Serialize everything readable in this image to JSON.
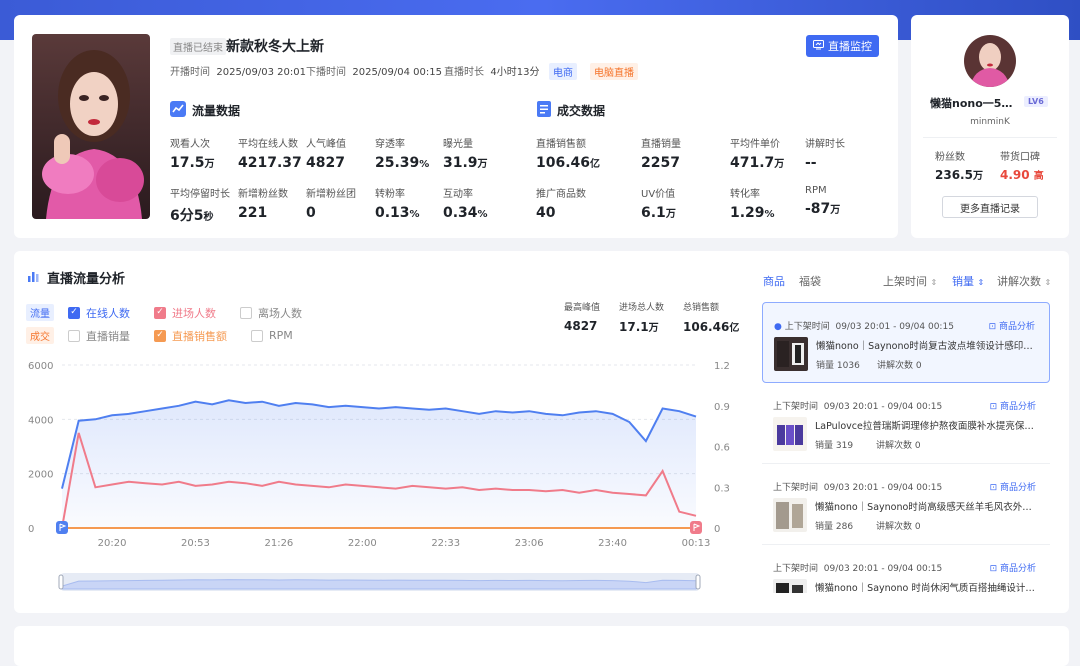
{
  "live": {
    "status_tag": "直播已结束",
    "title": "新款秋冬大上新",
    "monitor_button": "直播监控",
    "start_label": "开播时间",
    "start_time": "2025/09/03 20:01",
    "end_label": "下播时间",
    "end_time": "2025/09/04 00:15",
    "duration_label": "直播时长",
    "duration": "4小时13分",
    "tags": [
      "电商",
      "电脑直播"
    ]
  },
  "traffic": {
    "section_title": "流量数据",
    "metrics": [
      {
        "label": "观看人次",
        "value": "17.5",
        "unit": "万"
      },
      {
        "label": "平均在线人数",
        "value": "4217.37",
        "unit": ""
      },
      {
        "label": "人气峰值",
        "value": "4827",
        "unit": ""
      },
      {
        "label": "穿透率",
        "value": "25.39",
        "unit": "%"
      },
      {
        "label": "曝光量",
        "value": "31.9",
        "unit": "万"
      },
      {
        "label": "平均停留时长",
        "value": "6分5",
        "unit": "秒"
      },
      {
        "label": "新增粉丝数",
        "value": "221",
        "unit": ""
      },
      {
        "label": "新增粉丝团",
        "value": "0",
        "unit": ""
      },
      {
        "label": "转粉率",
        "value": "0.13",
        "unit": "%"
      },
      {
        "label": "互动率",
        "value": "0.34",
        "unit": "%"
      }
    ]
  },
  "sales": {
    "section_title": "成交数据",
    "metrics": [
      {
        "label": "直播销售额",
        "value": "106.46",
        "unit": "亿"
      },
      {
        "label": "直播销量",
        "value": "2257",
        "unit": ""
      },
      {
        "label": "平均件单价",
        "value": "471.7",
        "unit": "万"
      },
      {
        "label": "讲解时长",
        "value": "--",
        "unit": ""
      },
      {
        "label": "推广商品数",
        "value": "40",
        "unit": ""
      },
      {
        "label": "UV价值",
        "value": "6.1",
        "unit": "万"
      },
      {
        "label": "转化率",
        "value": "1.29",
        "unit": "%"
      },
      {
        "label": "RPM",
        "value": "-87",
        "unit": "万"
      }
    ]
  },
  "host": {
    "name": "懒猫nono一5…",
    "level": "LV6",
    "id": "minminK",
    "fans_label": "粉丝数",
    "fans_value": "236.5",
    "fans_unit": "万",
    "rep_label": "带货口碑",
    "rep_value": "4.90",
    "rep_unit": "高",
    "more_button": "更多直播记录"
  },
  "flow": {
    "title": "直播流量分析",
    "group_traffic": "流量",
    "group_sales": "成交",
    "legend_online": "在线人数",
    "legend_enter": "进场人数",
    "legend_leave": "离场人数",
    "legend_sales_vol": "直播销量",
    "legend_sales_amt": "直播销售额",
    "legend_rpm": "RPM",
    "summary": [
      {
        "label": "最高峰值",
        "value": "4827",
        "unit": ""
      },
      {
        "label": "进场总人数",
        "value": "17.1",
        "unit": "万"
      },
      {
        "label": "总销售额",
        "value": "106.46",
        "unit": "亿"
      }
    ]
  },
  "colors": {
    "online": "#4f7ff0",
    "enter": "#f07b8a",
    "sales_amt": "#f59a52",
    "accent": "#3f6af2"
  },
  "chart_data": {
    "type": "line",
    "x": [
      "20:01",
      "20:07",
      "20:13",
      "20:20",
      "20:26",
      "20:33",
      "20:40",
      "20:46",
      "20:53",
      "21:00",
      "21:06",
      "21:13",
      "21:20",
      "21:26",
      "21:33",
      "21:40",
      "21:46",
      "21:53",
      "22:00",
      "22:06",
      "22:13",
      "22:20",
      "22:26",
      "22:33",
      "22:40",
      "22:46",
      "22:53",
      "23:00",
      "23:06",
      "23:13",
      "23:20",
      "23:26",
      "23:33",
      "23:40",
      "23:46",
      "23:53",
      "24:00",
      "00:06",
      "00:13"
    ],
    "x_ticks": [
      "20:20",
      "20:53",
      "21:26",
      "22:00",
      "22:33",
      "23:06",
      "23:40",
      "00:13"
    ],
    "y_left_ticks": [
      "6000",
      "4000",
      "2000",
      "0"
    ],
    "y_right_ticks": [
      "1.2",
      "0.9",
      "0.6",
      "0.3",
      "0"
    ],
    "ylim_left": [
      0,
      6000
    ],
    "ylim_right": [
      0,
      1.2
    ],
    "series": [
      {
        "name": "在线人数",
        "values": [
          1450,
          3950,
          4000,
          4150,
          4200,
          4300,
          4400,
          4500,
          4650,
          4550,
          4700,
          4600,
          4650,
          4500,
          4600,
          4550,
          4450,
          4500,
          4450,
          4400,
          4450,
          4400,
          4350,
          4400,
          4300,
          4200,
          4300,
          4250,
          4300,
          4200,
          4150,
          4250,
          4300,
          4200,
          3900,
          3200,
          4400,
          4300,
          4100
        ]
      },
      {
        "name": "进场人数",
        "values": [
          0,
          3500,
          1500,
          1600,
          1700,
          1650,
          1600,
          1700,
          1550,
          1600,
          1700,
          1650,
          1550,
          1700,
          1600,
          1550,
          1500,
          1600,
          1550,
          1500,
          1450,
          1550,
          1500,
          1450,
          1500,
          1400,
          1450,
          1400,
          1400,
          1350,
          1400,
          1300,
          1400,
          1300,
          1250,
          1200,
          2100,
          600,
          450
        ]
      },
      {
        "name": "直播销售额",
        "values": [
          0,
          0,
          0,
          0,
          0,
          0,
          0,
          0,
          0,
          0,
          0,
          0,
          0,
          0,
          0,
          0,
          0,
          0,
          0,
          0,
          0,
          0,
          0,
          0,
          0,
          0,
          0,
          0,
          0,
          0,
          0,
          0,
          0,
          0,
          0,
          0,
          0,
          0,
          0
        ]
      }
    ]
  },
  "products": {
    "tab_products": "商品",
    "tab_bag": "福袋",
    "sort_time": "上架时间",
    "sort_sales": "销量",
    "sort_explain": "讲解次数",
    "items": [
      {
        "time_label": "上下架时间",
        "time": "09/03 20:01 - 09/04 00:15",
        "analysis": "商品分析",
        "name": "懒猫nono｜Saynono时尚复古波点堆领设计感印…",
        "sold_label": "销量",
        "sold": "1036",
        "explain_label": "讲解次数",
        "explain": "0"
      },
      {
        "time_label": "上下架时间",
        "time": "09/03 20:01 - 09/04 00:15",
        "analysis": "商品分析",
        "name": "LaPulovce拉普瑞斯调理修护熬夜面膜补水提亮保…",
        "sold_label": "销量",
        "sold": "319",
        "explain_label": "讲解次数",
        "explain": "0"
      },
      {
        "time_label": "上下架时间",
        "time": "09/03 20:01 - 09/04 00:15",
        "analysis": "商品分析",
        "name": "懒猫nono｜Saynono时尚高级感天丝羊毛风衣外…",
        "sold_label": "销量",
        "sold": "286",
        "explain_label": "讲解次数",
        "explain": "0"
      },
      {
        "time_label": "上下架时间",
        "time": "09/03 20:01 - 09/04 00:15",
        "analysis": "商品分析",
        "name": "懒猫nono｜Saynono 时尚休闲气质百搭抽绳设计…",
        "sold_label": "销量",
        "sold": "",
        "explain_label": "讲解次数",
        "explain": ""
      }
    ]
  }
}
